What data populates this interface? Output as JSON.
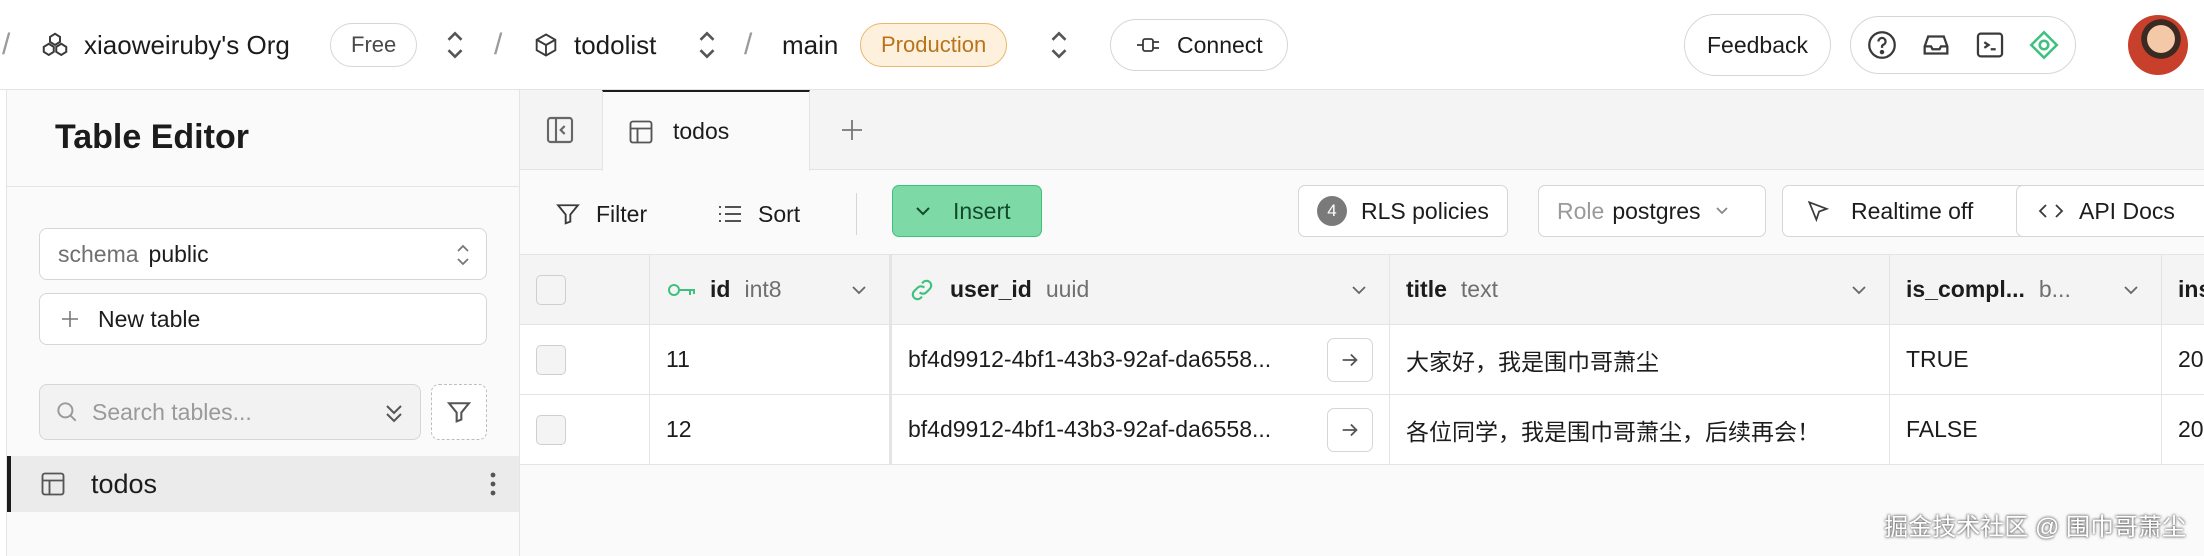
{
  "topbar": {
    "org_name": "xiaoweiruby's Org",
    "plan_badge": "Free",
    "project_name": "todolist",
    "branch_name": "main",
    "env_badge": "Production",
    "connect_label": "Connect",
    "feedback_label": "Feedback"
  },
  "sidebar": {
    "title": "Table Editor",
    "schema_label": "schema",
    "schema_value": "public",
    "new_table_label": "New table",
    "search_placeholder": "Search tables...",
    "items": [
      {
        "label": "todos"
      }
    ]
  },
  "tabs": [
    {
      "label": "todos"
    }
  ],
  "toolbar": {
    "filter_label": "Filter",
    "sort_label": "Sort",
    "insert_label": "Insert",
    "rls_count": "4",
    "rls_label": "RLS policies",
    "role_label": "Role",
    "role_value": "postgres",
    "realtime_label": "Realtime off",
    "api_docs_label": "API Docs"
  },
  "grid": {
    "columns": [
      {
        "name": "id",
        "type": "int8"
      },
      {
        "name": "user_id",
        "type": "uuid"
      },
      {
        "name": "title",
        "type": "text"
      },
      {
        "name": "is_compl...",
        "type": "b..."
      },
      {
        "name": "ins",
        "type": ""
      }
    ],
    "rows": [
      {
        "id": "11",
        "user_id": "bf4d9912-4bf1-43b3-92af-da6558...",
        "title": "大家好，我是围巾哥萧尘",
        "is_completed": "TRUE",
        "inserted_at": "20"
      },
      {
        "id": "12",
        "user_id": "bf4d9912-4bf1-43b3-92af-da6558...",
        "title": "各位同学，我是围巾哥萧尘，后续再会！",
        "is_completed": "FALSE",
        "inserted_at": "20"
      }
    ]
  },
  "watermark": "掘金技术社区 @ 围巾哥萧尘",
  "colors": {
    "insert_bg": "#7dd9a6",
    "production_bg": "#fdf1de",
    "production_text": "#b8731b",
    "key_icon": "#3ec17e"
  }
}
